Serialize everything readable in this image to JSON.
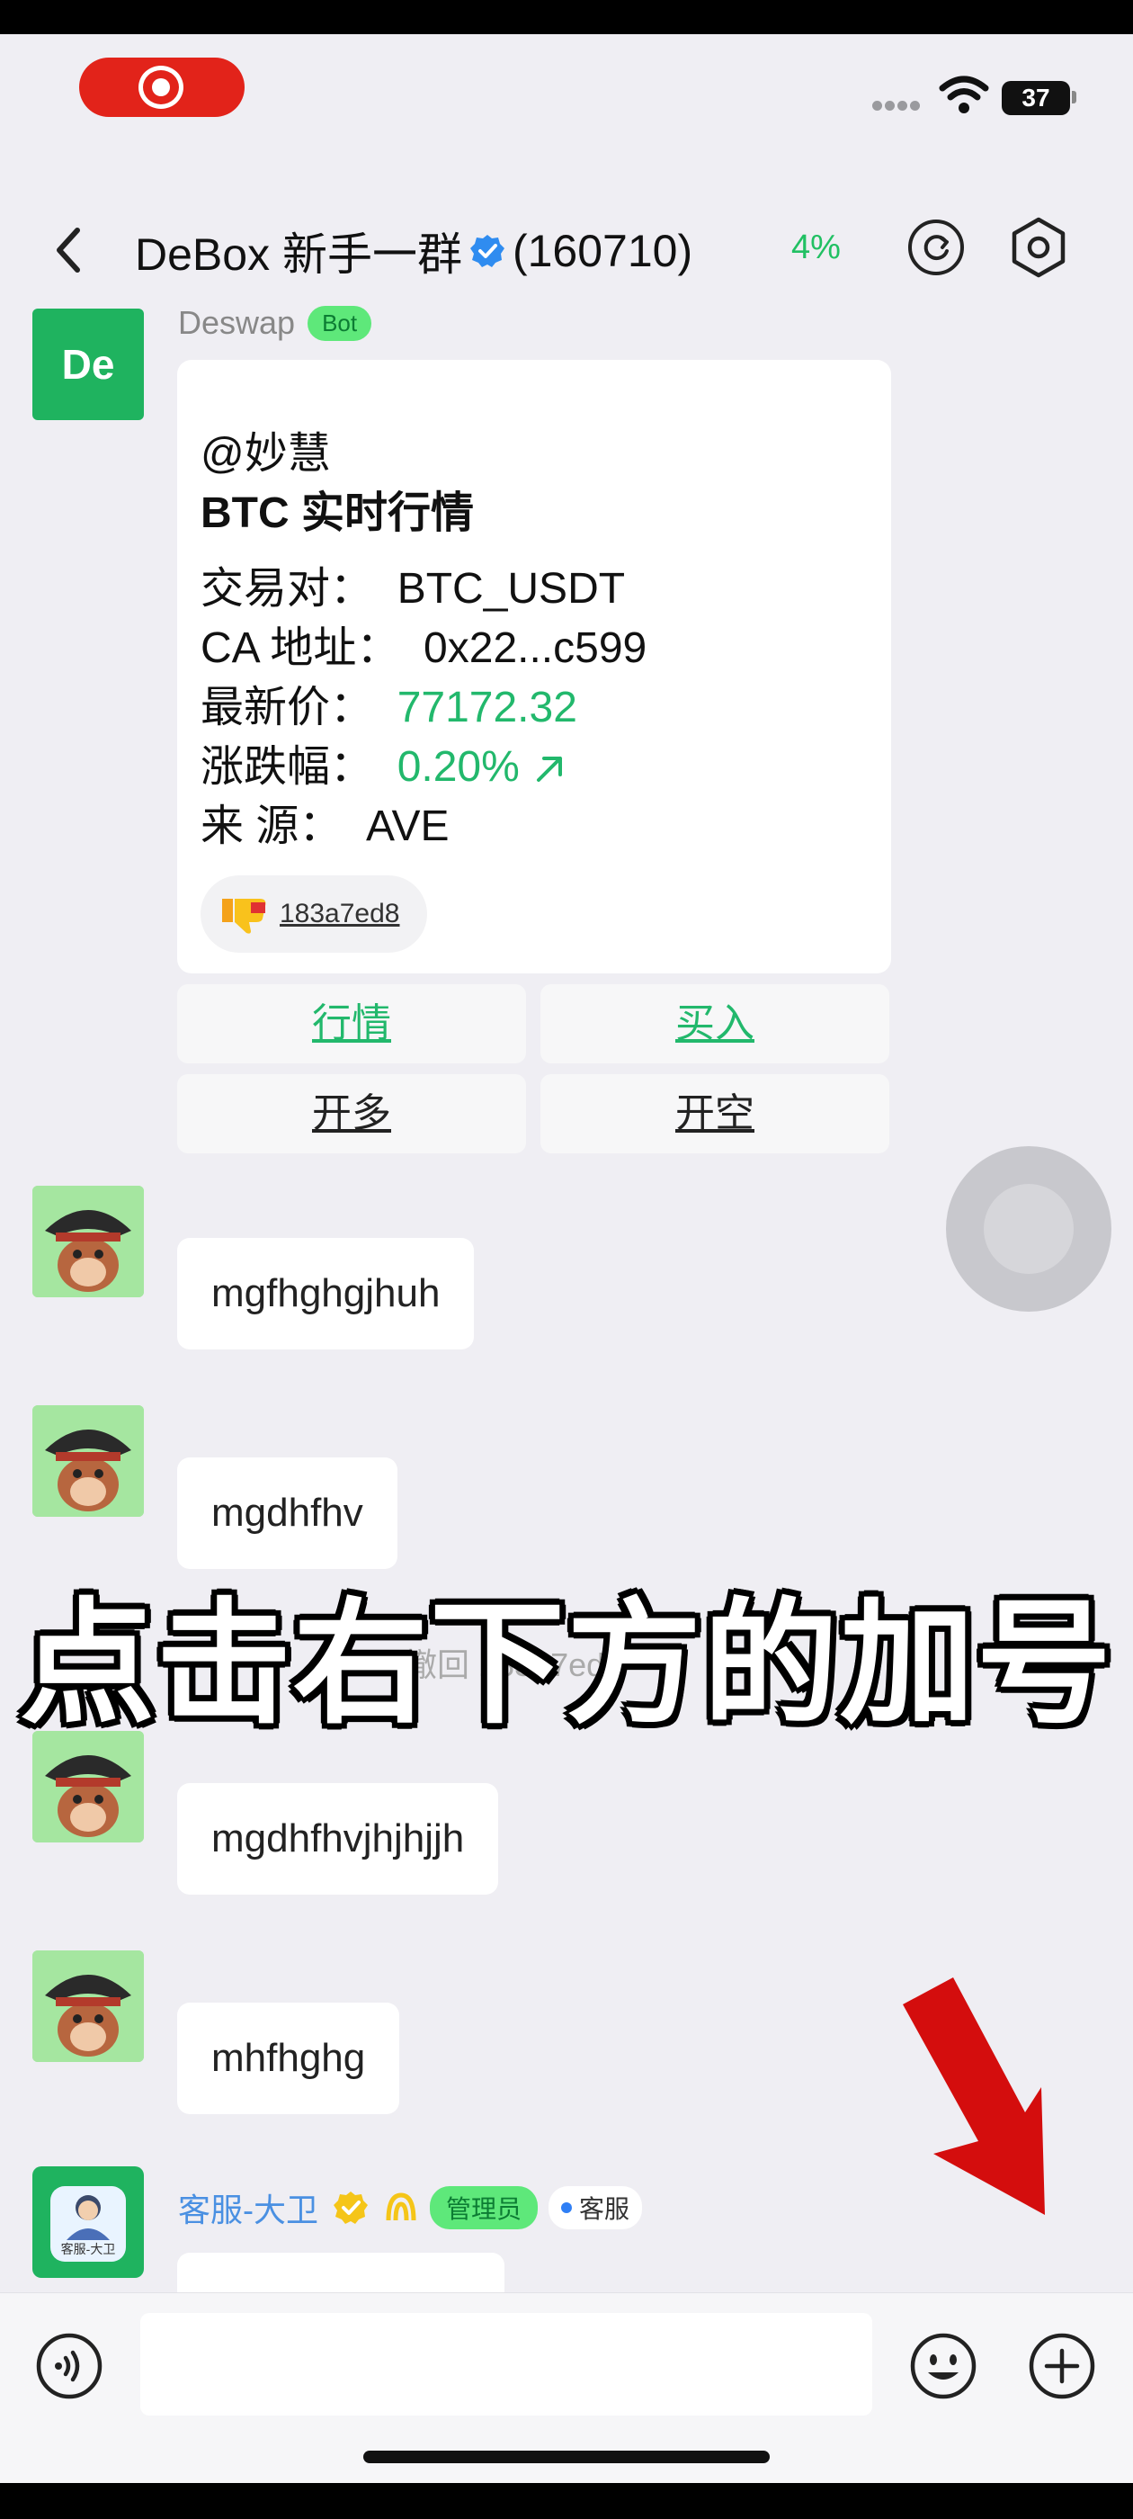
{
  "status_bar": {
    "battery": "37"
  },
  "header": {
    "group_name": "DeBox 新手一群",
    "member_count": "(160710)",
    "percent": "4%"
  },
  "bot_message": {
    "sender": "Deswap",
    "tag": "Bot",
    "avatar_text": "De",
    "mention": "@妙慧",
    "heading": "BTC 实时行情",
    "rows": [
      {
        "label": "交易对：",
        "value": "BTC_USDT"
      },
      {
        "label": "CA 地址：",
        "value": "0x22...c599"
      },
      {
        "label": "最新价：",
        "value": "77172.32"
      },
      {
        "label": "涨跌幅：",
        "value": "0.20%"
      },
      {
        "label": "来  源：",
        "value": "AVE"
      }
    ],
    "fingerprint": "183a7ed8",
    "buttons": [
      "行情",
      "买入",
      "开多",
      "开空"
    ]
  },
  "messages": [
    "mgfhghgjhuh",
    "mgdhfhv",
    "mgdhfhvjhjhjjh",
    "mhfhghg"
  ],
  "recall_notice": "撤回 183a7ed8",
  "caption": "点击右下方的加号",
  "service_message": {
    "sender": "客服-大卫",
    "admin_tag": "管理员",
    "service_tag": "客服",
    "avatar_label": "客服-大卫"
  },
  "input": {
    "placeholder": ""
  },
  "colors": {
    "accent_green": "#22b86c",
    "record_red": "#e2231a",
    "arrow_red": "#d40d0d"
  }
}
